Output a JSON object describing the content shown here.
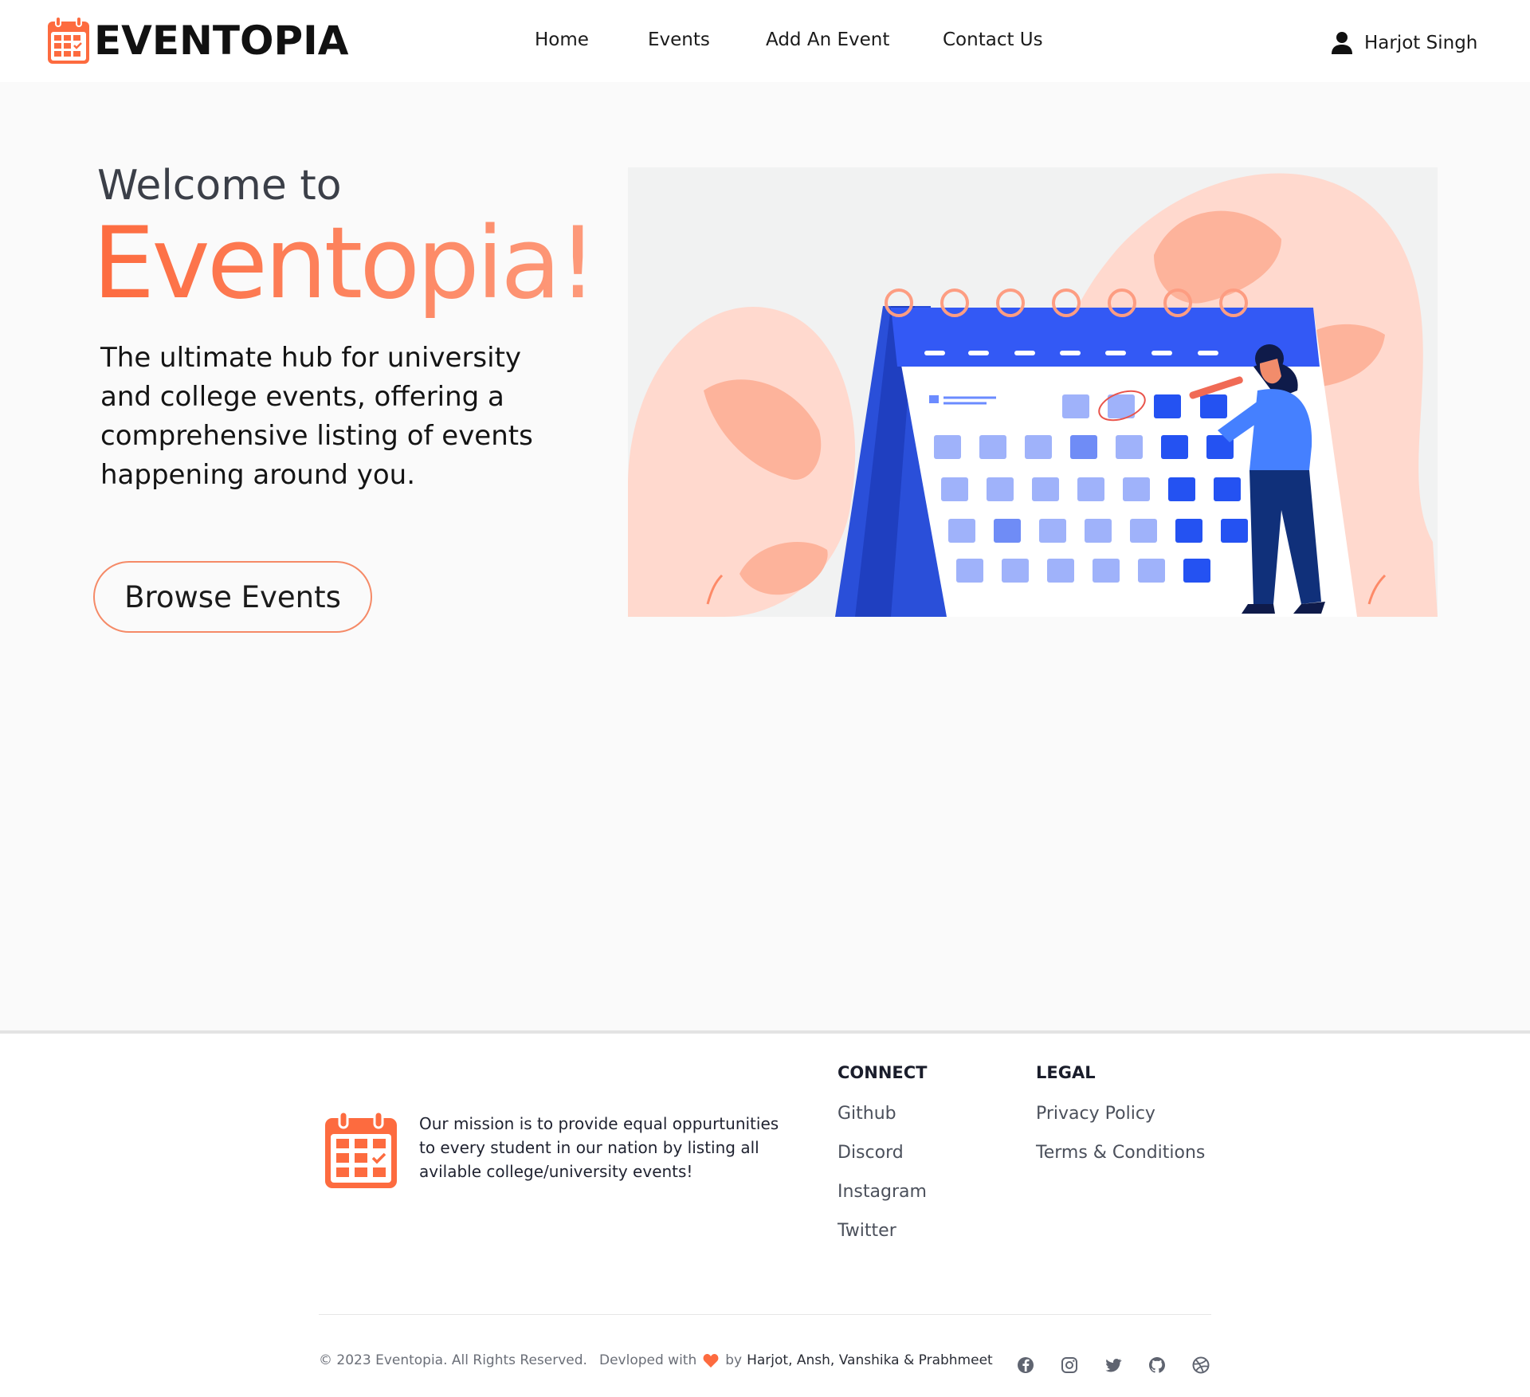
{
  "brand": {
    "name": "EVENTOPIA",
    "accent": "#fd6b3f"
  },
  "nav": {
    "links": [
      {
        "label": "Home"
      },
      {
        "label": "Events"
      },
      {
        "label": "Add An Event"
      },
      {
        "label": "Contact Us"
      }
    ],
    "user": {
      "name": "Harjot Singh",
      "icon": "user-icon"
    }
  },
  "hero": {
    "welcome": "Welcome to",
    "title": "Eventopia!",
    "tagline": "The ultimate hub for university and college events, offering a comprehensive listing of events happening around you.",
    "cta": "Browse Events",
    "illustration": "calendar-illustration"
  },
  "footer": {
    "mission": "Our mission is to provide equal oppurtunities to every student in our nation by listing all avilable college/university events!",
    "connect": {
      "heading": "CONNECT",
      "links": [
        "Github",
        "Discord",
        "Instagram",
        "Twitter"
      ]
    },
    "legal": {
      "heading": "LEGAL",
      "links": [
        "Privacy Policy",
        "Terms & Conditions"
      ]
    },
    "copyright": "© 2023 Eventopia. All Rights Reserved.",
    "developed_prefix": "Devloped with",
    "developed_by": "by",
    "developers": "Harjot, Ansh, Vanshika & Prabhmeet",
    "social_icons": [
      "facebook-icon",
      "instagram-icon",
      "twitter-icon",
      "github-icon",
      "dribbble-icon"
    ]
  }
}
